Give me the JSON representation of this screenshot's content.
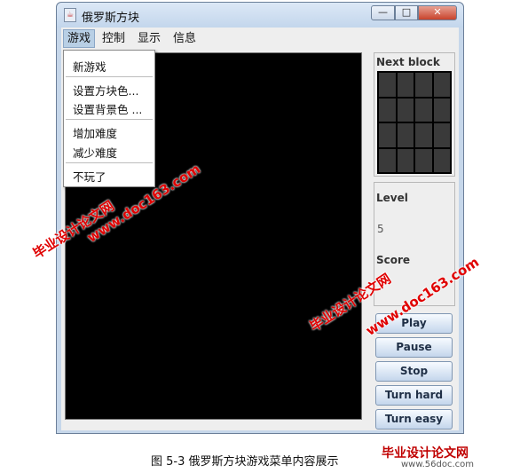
{
  "window": {
    "title": "俄罗斯方块",
    "buttons": {
      "minimize": "—",
      "maximize": "□",
      "close": "✕"
    }
  },
  "menubar": [
    "游戏",
    "控制",
    "显示",
    "信息"
  ],
  "dropdown": {
    "items": [
      "新游戏",
      "设置方块色...",
      "设置背景色 ...",
      "增加难度",
      "减少难度",
      "不玩了"
    ]
  },
  "side": {
    "next_block_label": "Next block",
    "level_label": "Level",
    "level_value": "5",
    "score_label": "Score",
    "score_value": ""
  },
  "buttons": [
    "Play",
    "Pause",
    "Stop",
    "Turn hard",
    "Turn easy"
  ],
  "caption": "图 5-3 俄罗斯方块游戏菜单内容展示",
  "watermarks": {
    "url": "www.doc163.com",
    "site": "毕业设计论文网",
    "footer_site": "毕业设计论文网",
    "footer_url": "www.56doc.com"
  }
}
